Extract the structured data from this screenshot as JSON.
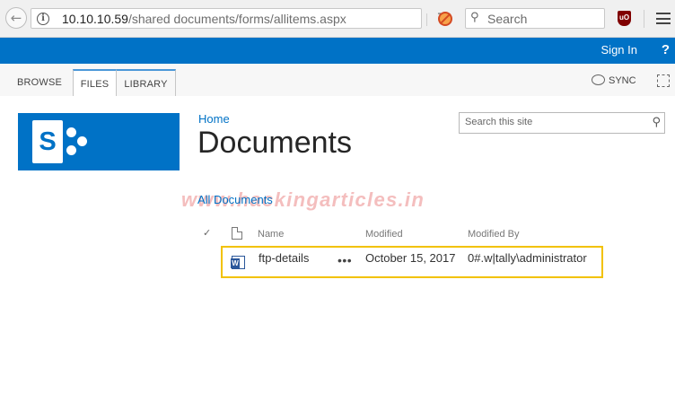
{
  "browser": {
    "url_host": "10.10.10.59",
    "url_path": "/shared documents/forms/allitems.aspx",
    "search_placeholder": "Search",
    "icons": [
      "back-arrow-icon",
      "info-icon",
      "reload-icon",
      "blocker-icon",
      "search-icon",
      "ublock-icon",
      "hamburger-menu-icon"
    ]
  },
  "suite_bar": {
    "signin_label": "Sign In",
    "help_label": "?",
    "color": "#0072c6"
  },
  "ribbon": {
    "tabs": [
      {
        "label": "BROWSE",
        "selected": false
      },
      {
        "label": "FILES",
        "selected": true
      },
      {
        "label": "LIBRARY",
        "selected": false
      }
    ],
    "sync_label": "SYNC"
  },
  "site": {
    "breadcrumb": "Home",
    "title": "Documents",
    "search_placeholder": "Search this site",
    "logo_letter": "S"
  },
  "watermark": "www.hackingarticles.in",
  "library": {
    "view_link": "All Documents",
    "columns": {
      "check": "✓",
      "name": "Name",
      "modified": "Modified",
      "modified_by": "Modified By"
    },
    "rows": [
      {
        "name": "ftp-details",
        "ellipsis": "•••",
        "modified": "October 15, 2017",
        "modified_by": "0#.w|tally\\administrator",
        "highlight_color": "#f2c200"
      }
    ]
  }
}
